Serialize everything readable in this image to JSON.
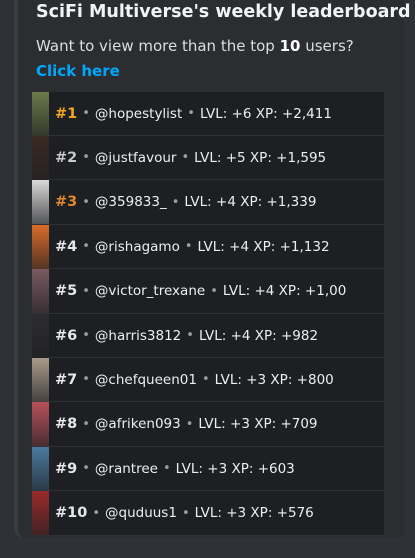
{
  "header": {
    "title": "SciFi Multiverse's weekly leaderboard",
    "subtitle_prefix": "Want to view more than the top ",
    "subtitle_count": "10",
    "subtitle_suffix": " users?",
    "link_label": "Click here"
  },
  "separator": "•",
  "leaderboard": [
    {
      "rank": "#1",
      "user": "@hopestylist",
      "stats": "LVL: +6 XP: +2,411",
      "tier": "gold",
      "avatar_color": "#6b7a4a"
    },
    {
      "rank": "#2",
      "user": "@justfavour",
      "stats": "LVL: +5 XP: +1,595",
      "tier": "silver",
      "avatar_color": "#3a2a22"
    },
    {
      "rank": "#3",
      "user": "@359833_",
      "stats": "LVL: +4 XP: +1,339",
      "tier": "bronze",
      "avatar_color": "#d9d9d9"
    },
    {
      "rank": "#4",
      "user": "@rishagamo",
      "stats": "LVL: +4 XP: +1,132",
      "tier": "plain",
      "avatar_color": "#d96b2a"
    },
    {
      "rank": "#5",
      "user": "@victor_trexane",
      "stats": "LVL: +4 XP: +1,00",
      "tier": "plain",
      "avatar_color": "#7a5a62"
    },
    {
      "rank": "#6",
      "user": "@harris3812",
      "stats": "LVL: +4 XP: +982",
      "tier": "plain",
      "avatar_color": "#2c2c30"
    },
    {
      "rank": "#7",
      "user": "@chefqueen01",
      "stats": "LVL: +3 XP: +800",
      "tier": "plain",
      "avatar_color": "#a89a8a"
    },
    {
      "rank": "#8",
      "user": "@afriken093",
      "stats": "LVL: +3 XP: +709",
      "tier": "plain",
      "avatar_color": "#b8505a"
    },
    {
      "rank": "#9",
      "user": "@rantree",
      "stats": "LVL: +3 XP: +603",
      "tier": "plain",
      "avatar_color": "#4a7aa0"
    },
    {
      "rank": "#10",
      "user": "@quduus1",
      "stats": "LVL: +3 XP: +576",
      "tier": "plain",
      "avatar_color": "#9a2a2a"
    }
  ]
}
